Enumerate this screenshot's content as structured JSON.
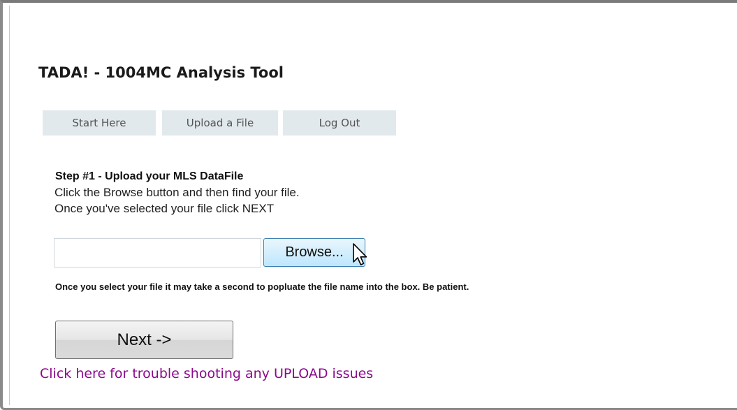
{
  "page": {
    "title": "TADA! - 1004MC Analysis Tool"
  },
  "nav": {
    "tabs": [
      {
        "label": "Start Here"
      },
      {
        "label": "Upload a File"
      },
      {
        "label": "Log Out"
      }
    ]
  },
  "step": {
    "title": "Step #1 - Upload your MLS DataFile",
    "instruction_1": "Click the Browse button and then find your file.",
    "instruction_2": "Once you've selected your file click NEXT"
  },
  "upload": {
    "file_value": "",
    "browse_label": "Browse...",
    "hint": "Once you select your file it may take a second to popluate the file name into the box. Be patient."
  },
  "actions": {
    "next_label": "Next ->",
    "trouble_link": "Click here for trouble shooting any UPLOAD issues"
  },
  "colors": {
    "tab_bg": "#e2e9ec",
    "link_visited": "#8b0a8b",
    "browse_border": "#3c7fb1"
  },
  "icons": {
    "cursor": "mouse-pointer-icon"
  }
}
